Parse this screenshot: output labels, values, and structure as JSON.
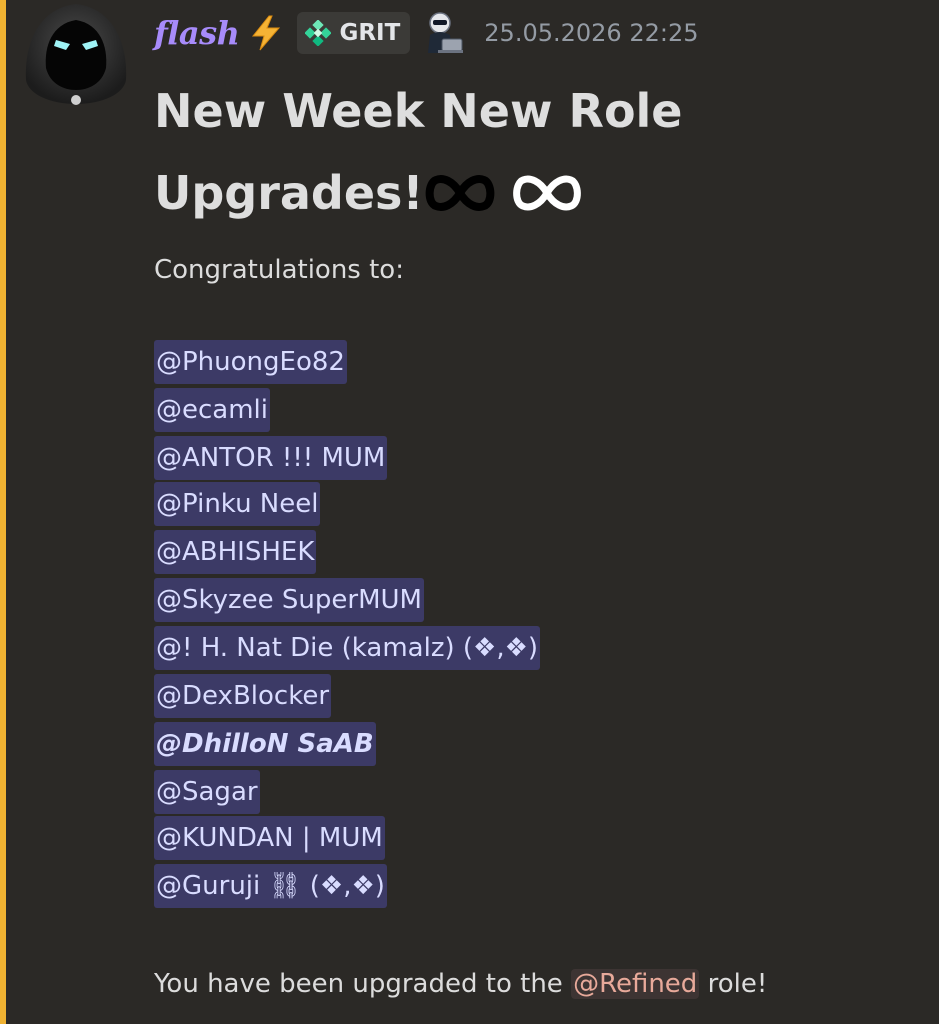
{
  "message": {
    "author": "flash",
    "author_emoji": "⚡",
    "tag": {
      "icon": "diamond-grid-icon",
      "text": "GRIT"
    },
    "badge_icon": "robot-laptop-icon",
    "timestamp": "25.05.2026 22:25",
    "title": "New Week New Role Upgrades!",
    "intro": "Congratulations to:",
    "mentions": [
      "@PhuongEo82",
      "@ecamli",
      "@ANTOR !!!  MUM",
      "@Pinku Neel",
      "@ABHISHEK",
      "@Skyzee SuperMUM",
      "@! H. Nat Die (kamalz) (❖,❖)",
      "@DexBlocker",
      "@DhilloN SaAB",
      "@Sagar",
      "@KUNDAN | MUM",
      "@Guruji ⛓ (❖,❖)"
    ],
    "footer": {
      "before": "You have been upgraded to the ",
      "role_mention": "@Refined",
      "after": " role!"
    }
  },
  "colors": {
    "background": "#2b2926",
    "accent_bar": "#f0b232",
    "author": "#a78bfa",
    "mention_bg": "#3c3a66",
    "mention_text": "#d9dcff",
    "role_mention_bg": "#3d3433",
    "role_mention_text": "#e8a99a",
    "timestamp": "#949ba4"
  }
}
